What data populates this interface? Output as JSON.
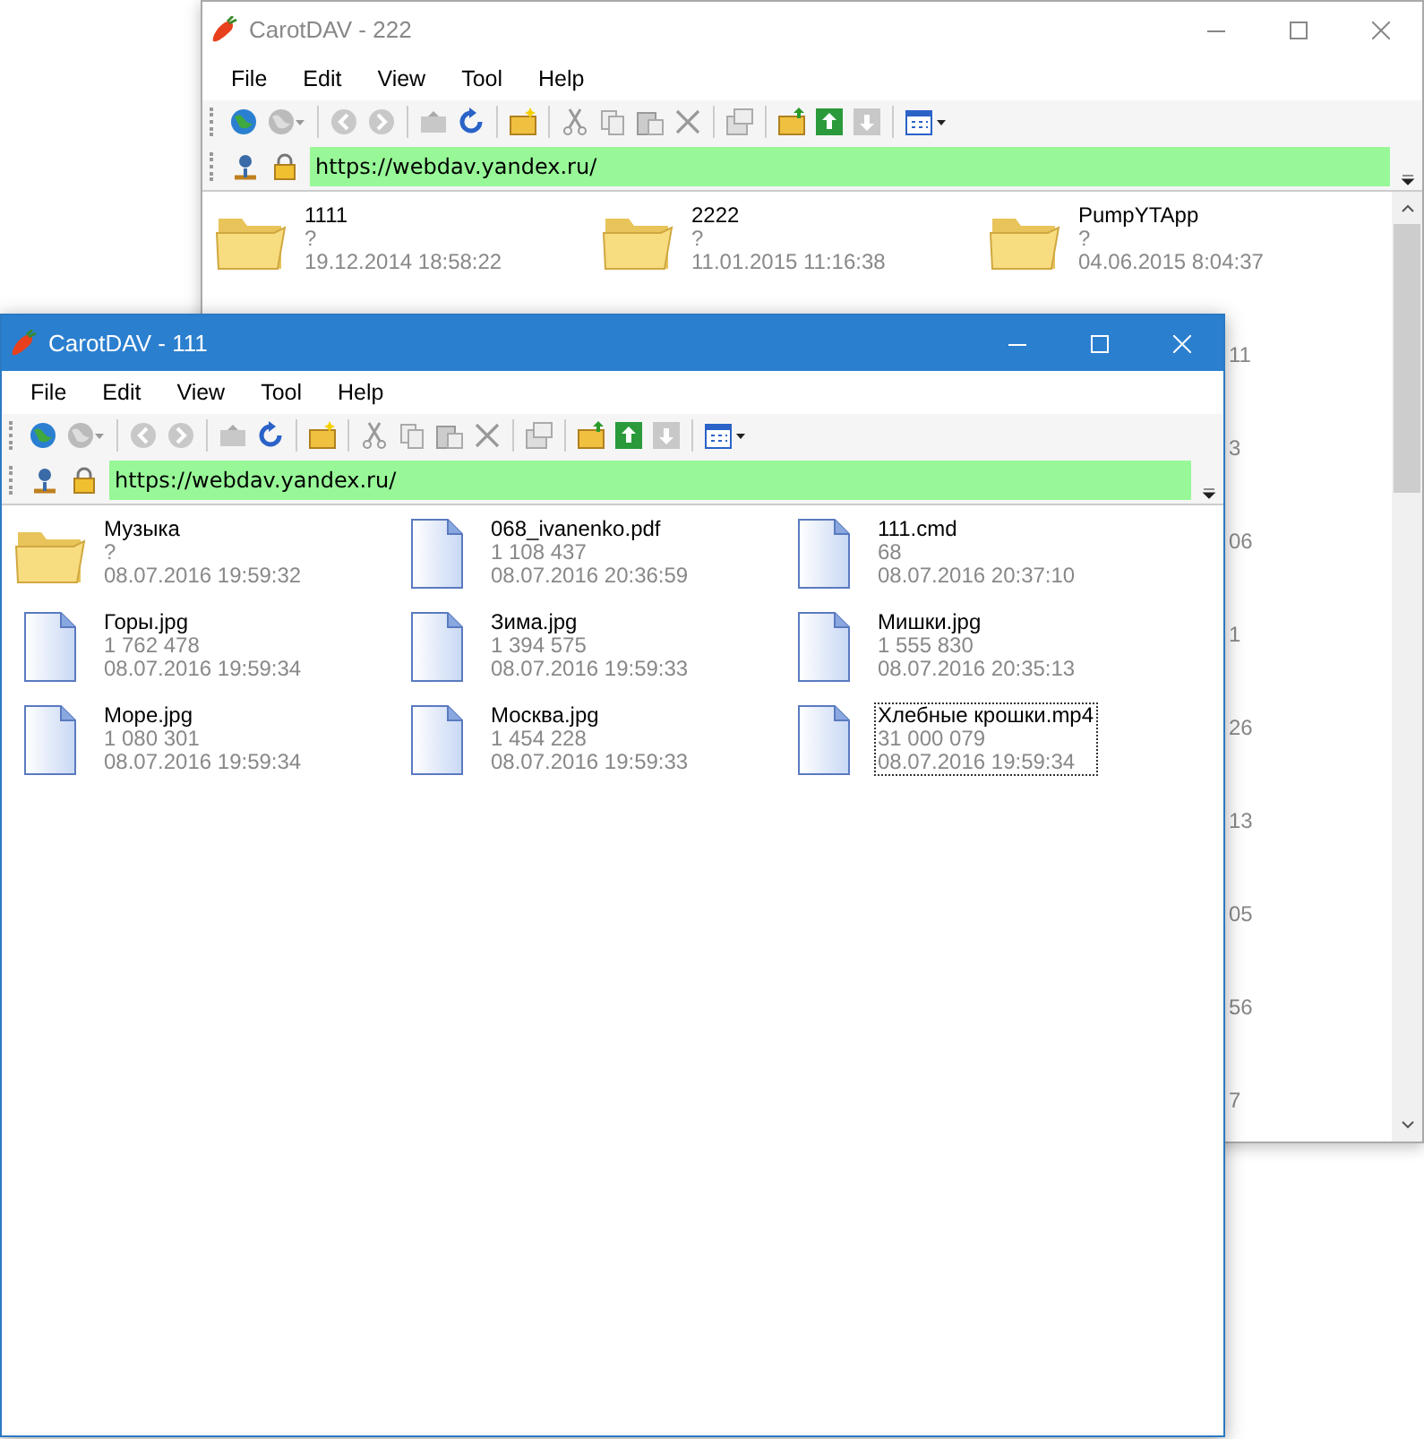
{
  "windows": [
    {
      "title": "CarotDAV - 222",
      "active": false,
      "menu": [
        "File",
        "Edit",
        "View",
        "Tool",
        "Help"
      ],
      "address": "https://webdav.yandex.ru/",
      "scrollbar": true,
      "items": [
        {
          "kind": "folder",
          "name": "1111",
          "size": "?",
          "date": "19.12.2014 18:58:22",
          "focused": false
        },
        {
          "kind": "folder",
          "name": "2222",
          "size": "?",
          "date": "11.01.2015 11:16:38",
          "focused": false
        },
        {
          "kind": "folder",
          "name": "PumpYTApp",
          "size": "?",
          "date": "04.06.2015 8:04:37",
          "focused": false
        }
      ],
      "right_edge_fragments": [
        "11",
        "3",
        "06",
        "1",
        "26",
        "13",
        "05",
        "56",
        "7"
      ]
    },
    {
      "title": "CarotDAV - 111",
      "active": true,
      "menu": [
        "File",
        "Edit",
        "View",
        "Tool",
        "Help"
      ],
      "address": "https://webdav.yandex.ru/",
      "items": [
        {
          "kind": "folder",
          "name": "Музыка",
          "size": "?",
          "date": "08.07.2016 19:59:32",
          "focused": false
        },
        {
          "kind": "file",
          "name": "068_ivanenko.pdf",
          "size": "1 108 437",
          "date": "08.07.2016 20:36:59",
          "focused": false
        },
        {
          "kind": "file",
          "name": "111.cmd",
          "size": "68",
          "date": "08.07.2016 20:37:10",
          "focused": false
        },
        {
          "kind": "file",
          "name": "Горы.jpg",
          "size": "1 762 478",
          "date": "08.07.2016 19:59:34",
          "focused": false
        },
        {
          "kind": "file",
          "name": "Зима.jpg",
          "size": "1 394 575",
          "date": "08.07.2016 19:59:33",
          "focused": false
        },
        {
          "kind": "file",
          "name": "Мишки.jpg",
          "size": "1 555 830",
          "date": "08.07.2016 20:35:13",
          "focused": false
        },
        {
          "kind": "file",
          "name": "Море.jpg",
          "size": "1 080 301",
          "date": "08.07.2016 19:59:34",
          "focused": false
        },
        {
          "kind": "file",
          "name": "Москва.jpg",
          "size": "1 454 228",
          "date": "08.07.2016 19:59:33",
          "focused": false
        },
        {
          "kind": "file",
          "name": "Хлебные крошки.mp4",
          "size": "31 000 079",
          "date": "08.07.2016 19:59:34",
          "focused": true
        }
      ]
    }
  ]
}
